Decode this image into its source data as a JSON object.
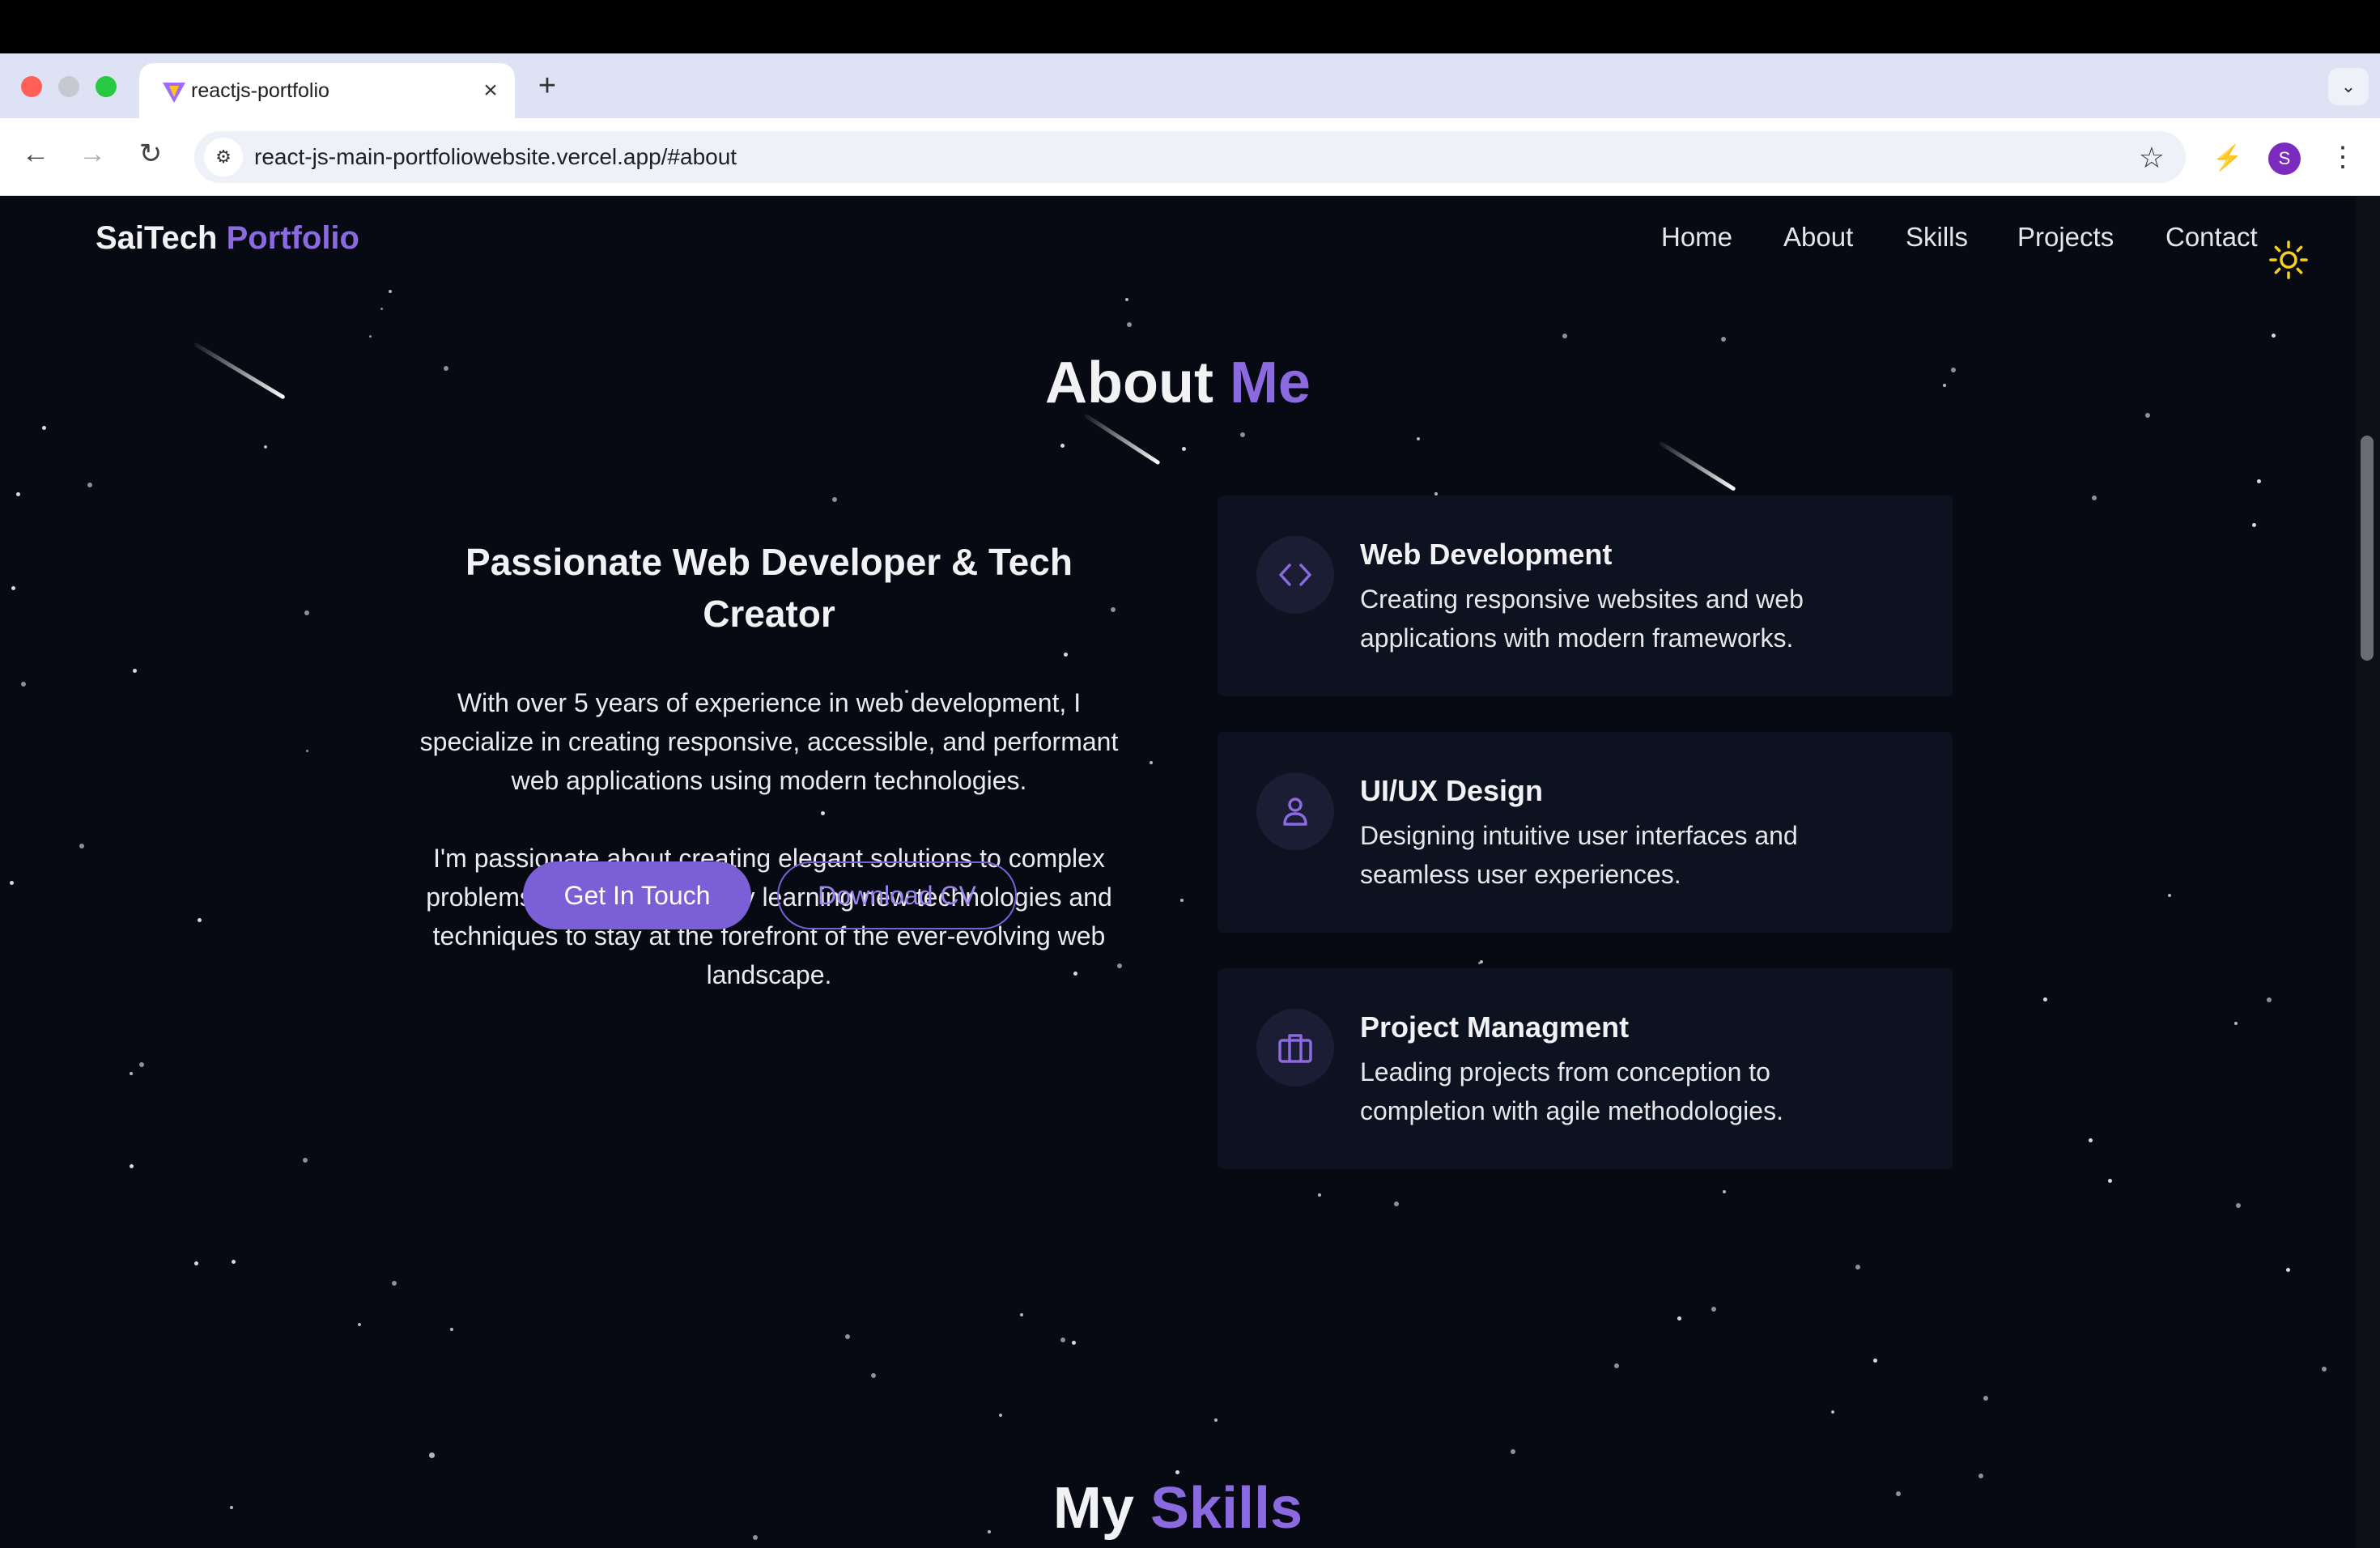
{
  "browser": {
    "tab_title": "reactjs-portfolio",
    "tab_close": "×",
    "new_tab": "+",
    "url": "react-js-main-portfoliowebsite.vercel.app/#about",
    "profile_initial": "S",
    "icons": [
      "back-icon",
      "forward-icon",
      "reload-icon",
      "site-info-icon",
      "star-icon",
      "extension-icon",
      "kebab-menu-icon",
      "chevron-down-icon"
    ]
  },
  "site": {
    "brand_main": "SaiTech",
    "brand_accent": "Portfolio",
    "nav": [
      "Home",
      "About",
      "Skills",
      "Projects",
      "Contact"
    ],
    "theme_icon": "sun-icon"
  },
  "about": {
    "title_main": "About",
    "title_accent": "Me",
    "headline_line1": "Passionate Web Developer & Tech",
    "headline_line2": "Creator",
    "para1_lines": [
      "With over 5 years of experience in web development, I",
      "specialize in creating responsive, accessible, and performant",
      "web applications using modern technologies."
    ],
    "para2_lines": [
      "I'm passionate about creating elegant solutions to complex",
      "problems, and I'm constantly learning new technologies and",
      "techniques to stay at the forefront of the ever-evolving web",
      "landscape."
    ],
    "btn_contact": "Get In Touch",
    "btn_cv": "Download CV",
    "cards": [
      {
        "icon": "code-icon",
        "title": "Web Development",
        "desc_line1": "Creating responsive websites and web",
        "desc_line2": "applications with modern frameworks."
      },
      {
        "icon": "user-icon",
        "title": "UI/UX Design",
        "desc_line1": "Designing intuitive user interfaces and",
        "desc_line2": "seamless user experiences."
      },
      {
        "icon": "briefcase-icon",
        "title": "Project Managment",
        "desc_line1": "Leading projects from conception to",
        "desc_line2": "completion with agile methodologies."
      }
    ]
  },
  "skills": {
    "title_main": "My",
    "title_accent": "Skills"
  },
  "colors": {
    "accent": "#8b6ae0",
    "button": "#7b5fd6",
    "background": "#070a12",
    "card": "#0c1220",
    "sun": "#f5d020"
  }
}
